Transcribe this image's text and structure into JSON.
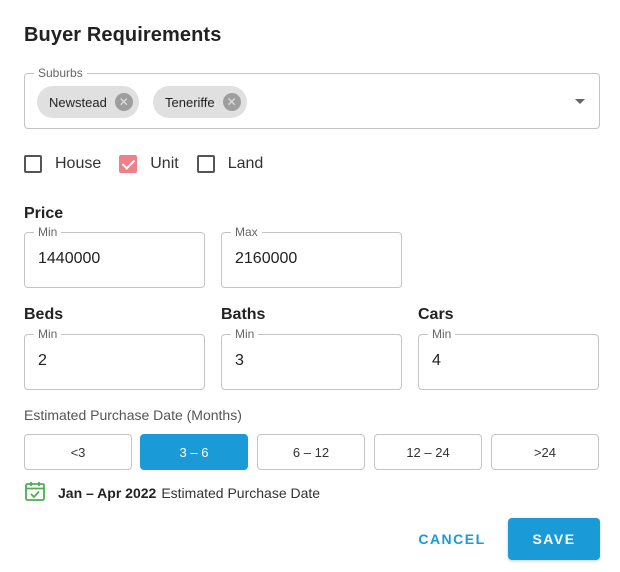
{
  "dialog": {
    "title": "Buyer Requirements"
  },
  "suburbs": {
    "label": "Suburbs",
    "chips": [
      {
        "label": "Newstead"
      },
      {
        "label": "Teneriffe"
      }
    ],
    "dropdown_icon": "arrow-drop-down-icon"
  },
  "property_types": [
    {
      "label": "House",
      "checked": false
    },
    {
      "label": "Unit",
      "checked": true
    },
    {
      "label": "Land",
      "checked": false
    }
  ],
  "price": {
    "label": "Price",
    "min": {
      "label": "Min",
      "value": "1440000"
    },
    "max": {
      "label": "Max",
      "value": "2160000"
    }
  },
  "beds": {
    "label": "Beds",
    "min_label": "Min",
    "value": "2"
  },
  "baths": {
    "label": "Baths",
    "min_label": "Min",
    "value": "3"
  },
  "cars": {
    "label": "Cars",
    "min_label": "Min",
    "value": "4"
  },
  "purchase_date": {
    "label": "Estimated Purchase Date (Months)",
    "options": [
      "<3",
      "3 – 6",
      "6 – 12",
      "12 – 24",
      ">24"
    ],
    "selected_index": 1,
    "estimate_range": "Jan – Apr 2022",
    "estimate_suffix": "Estimated Purchase Date",
    "estimate_icon": "calendar-check-icon"
  },
  "actions": {
    "cancel": "CANCEL",
    "save": "SAVE"
  },
  "colors": {
    "accent": "#1a9ad6",
    "checkbox_checked": "#f07f87",
    "calendar_icon": "#4caf50"
  }
}
